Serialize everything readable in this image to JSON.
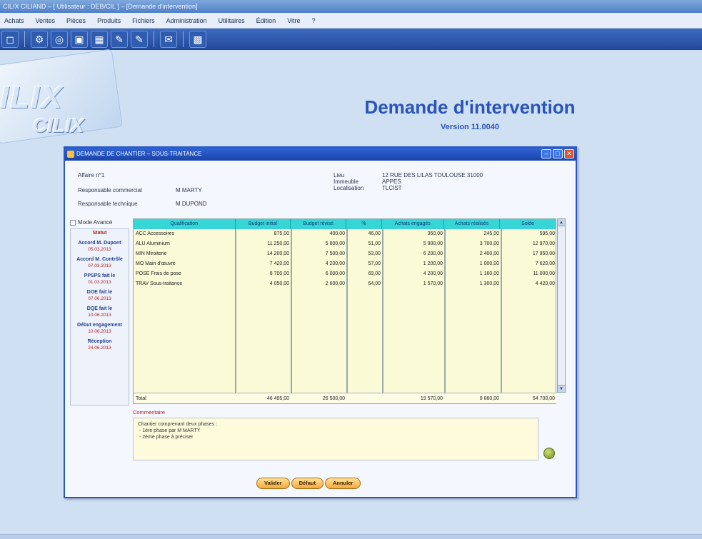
{
  "window": {
    "title": "CILIX CILIAND – [ Utilisateur : DEB/CIL ] – [Demande d'intervention]"
  },
  "menu": [
    "Achats",
    "Ventes",
    "Pièces",
    "Produits",
    "Fichiers",
    "Administration",
    "Utilitaires",
    "Édition",
    "Vitre",
    "?"
  ],
  "toolbar": {
    "icons": [
      "door-icon",
      "gear-icon",
      "globe-icon",
      "box-icon",
      "table-icon",
      "notepad-icon",
      "notepad-icon",
      "mail-icon",
      "chart-icon"
    ]
  },
  "logo": {
    "main": "ILIX",
    "sub": "CILIX"
  },
  "header": {
    "title": "Demande d'intervention",
    "version": "Version 11.0040"
  },
  "dialog": {
    "title": "DEMANDE DE CHANTIER – SOUS-TRAITANCE",
    "affaire": "Affaire n°1",
    "resp_commercial_label": "Responsable commercial",
    "resp_commercial_value": "M MARTY",
    "resp_technique_label": "Responsable technique",
    "resp_technique_value": "M DUPOND",
    "lieu_label": "Lieu",
    "lieu_value": "12 RUE DES LILAS TOULOUSE 31000",
    "immeuble_label": "Immeuble",
    "immeuble_value": "APPES",
    "localisation_label": "Localisation",
    "localisation_value": "TLCIST",
    "mode_avance": "Mode Avancé"
  },
  "status_items": [
    {
      "label": "Statut",
      "date": ""
    },
    {
      "label": "Accord M. Dupont",
      "date": "05.03.2013"
    },
    {
      "label": "Accord M. Contrôle",
      "date": "07.03.2013"
    },
    {
      "label": "PPSPS fait le",
      "date": "01.03.2013"
    },
    {
      "label": "DOE fait le",
      "date": "07.06.2013"
    },
    {
      "label": "DQE fait le",
      "date": "10.06.2013"
    },
    {
      "label": "Début engagement",
      "date": "10.06.2013"
    },
    {
      "label": "Réception",
      "date": "24.06.2013"
    }
  ],
  "table": {
    "headers": [
      "Qualification",
      "Budget initial",
      "Budget révisé",
      "%",
      "Achats engagés",
      "Achats réalisés",
      "Solde"
    ],
    "rows": [
      [
        "ACC   Accessoires",
        "875,00",
        "400,00",
        "46,00",
        "350,00",
        "245,00",
        "595,00"
      ],
      [
        "ALU   Aluminium",
        "11 250,00",
        "5 800,00",
        "51,00",
        "5 900,00",
        "3 700,00",
        "12 970,00"
      ],
      [
        "MIN   Miroiterie",
        "14 200,00",
        "7 500,00",
        "53,00",
        "6 200,00",
        "2 400,00",
        "17 950,00"
      ],
      [
        "MO   Main d'œuvre",
        "7 420,00",
        "4 200,00",
        "57,00",
        "1 200,00",
        "1 000,00",
        "7 620,00"
      ],
      [
        "POSE   Frais de pose",
        "8 700,00",
        "6 000,00",
        "69,00",
        "4 200,00",
        "1 160,00",
        "11 000,00"
      ],
      [
        "TRAV   Sous-traitance",
        "4 050,00",
        "2 600,00",
        "64,00",
        "1 570,00",
        "1 300,00",
        "4 420,00"
      ]
    ],
    "total_label": "Total",
    "totals": [
      "46 495,00",
      "26 500,00",
      "",
      "19 570,00",
      "9 860,00",
      "54 700,00"
    ]
  },
  "commentaire": {
    "label": "Commentaire",
    "text": "Chantier comprenant deux phases :\n - 1ère phase par M MARTY\n - 2ème phase à préciser"
  },
  "buttons": {
    "valider": "Valider",
    "defaut": "Défaut",
    "annuler": "Annuler"
  }
}
